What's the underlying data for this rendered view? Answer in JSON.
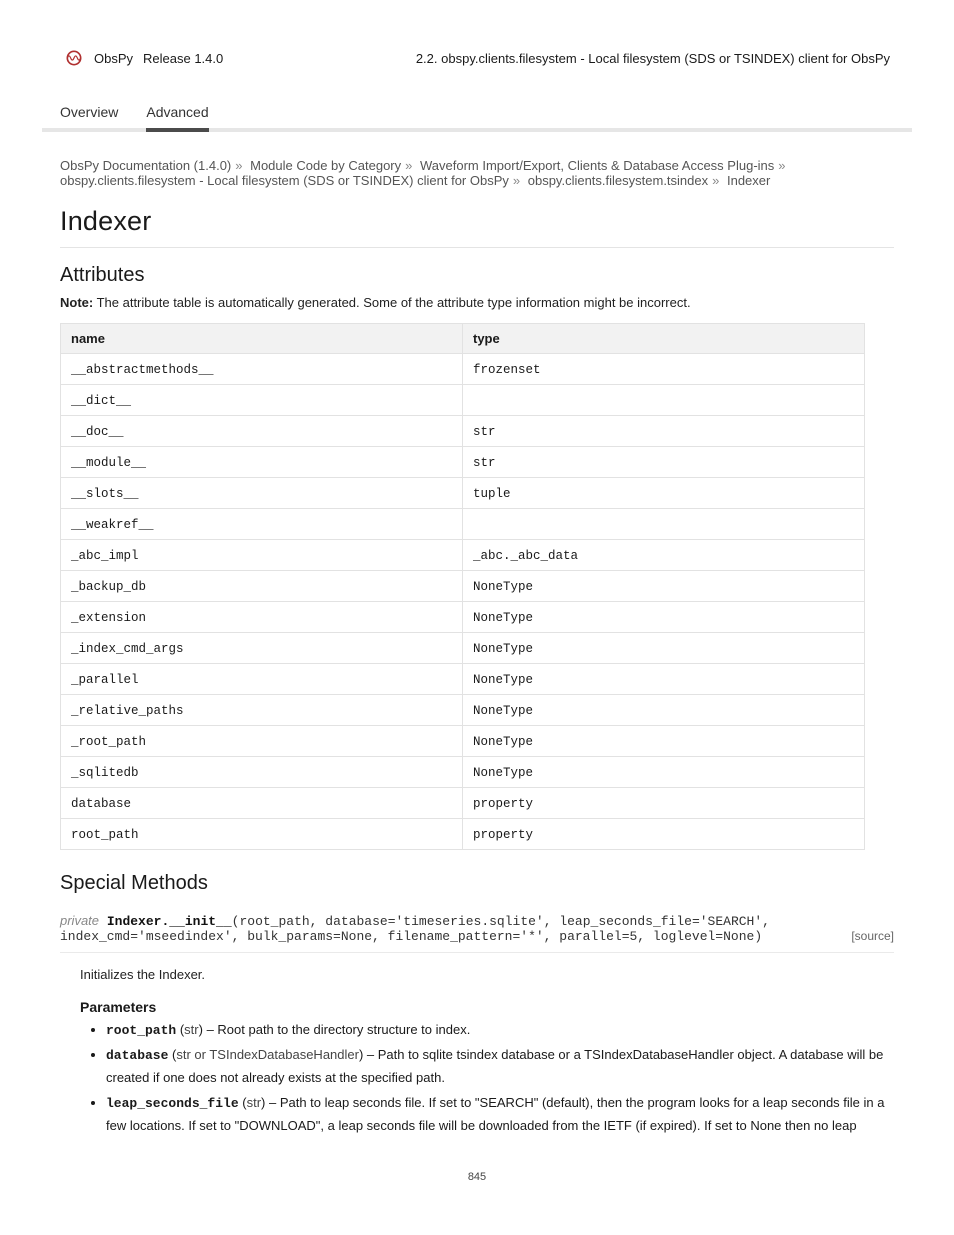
{
  "header": {
    "library": "ObsPy",
    "version": "Release 1.4.0",
    "section": "2.2. obspy.clients.filesystem - Local filesystem (SDS or TSINDEX) client for ObsPy"
  },
  "tabs": [
    {
      "label": "Overview"
    },
    {
      "label": "Advanced"
    }
  ],
  "crumbs": [
    "ObsPy Documentation (1.4.0)",
    "Module Code by Category",
    "Waveform Import/Export, Clients & Database Access Plug-ins",
    "obspy.clients.filesystem - Local filesystem (SDS or TSINDEX) client for ObsPy",
    "obspy.clients.filesystem.tsindex",
    "Indexer"
  ],
  "page_title": "Indexer",
  "section_attr": {
    "heading": "Attributes",
    "table": {
      "headers": [
        "name",
        "type"
      ],
      "rows": [
        [
          "__abstractmethods__",
          "frozenset"
        ],
        [
          "__dict__",
          ""
        ],
        [
          "__doc__",
          "str"
        ],
        [
          "__module__",
          "str"
        ],
        [
          "__slots__",
          "tuple"
        ],
        [
          "__weakref__",
          ""
        ],
        [
          "_abc_impl",
          "_abc._abc_data"
        ],
        [
          "_backup_db",
          "NoneType"
        ],
        [
          "_extension",
          "NoneType"
        ],
        [
          "_index_cmd_args",
          "NoneType"
        ],
        [
          "_parallel",
          "NoneType"
        ],
        [
          "_relative_paths",
          "NoneType"
        ],
        [
          "_root_path",
          "NoneType"
        ],
        [
          "_sqlitedb",
          "NoneType"
        ],
        [
          "database",
          "property"
        ],
        [
          "root_path",
          "property"
        ]
      ]
    }
  },
  "section_methods": {
    "heading": "Special Methods",
    "func": {
      "kw": "private",
      "name": "Indexer.__init__",
      "args": "(root_path, database='timeseries.sqlite', leap_seconds_file='SEARCH', index_cmd='mseedindex', bulk_params=None, filename_pattern='*', parallel=5, loglevel=None)",
      "source": "[source]"
    },
    "desc": "Initializes the Indexer.",
    "params_label": "Parameters",
    "params": [
      {
        "name": "root_path",
        "type": "str",
        "desc": "Root path to the directory structure to index."
      },
      {
        "name": "database",
        "type": "str or TSIndexDatabaseHandler",
        "desc": "Path to sqlite tsindex database or a TSIndexDatabaseHandler object. A database will be created if one does not already exists at the specified path."
      },
      {
        "name": "leap_seconds_file",
        "type": "str",
        "desc": "Path to leap seconds file. If set to \"SEARCH\" (default), then the program looks for a leap seconds file in a few locations. If set to \"DOWNLOAD\", a leap seconds file will be downloaded from the IETF (if expired). If set to None then no leap"
      }
    ]
  },
  "page_number": "845"
}
